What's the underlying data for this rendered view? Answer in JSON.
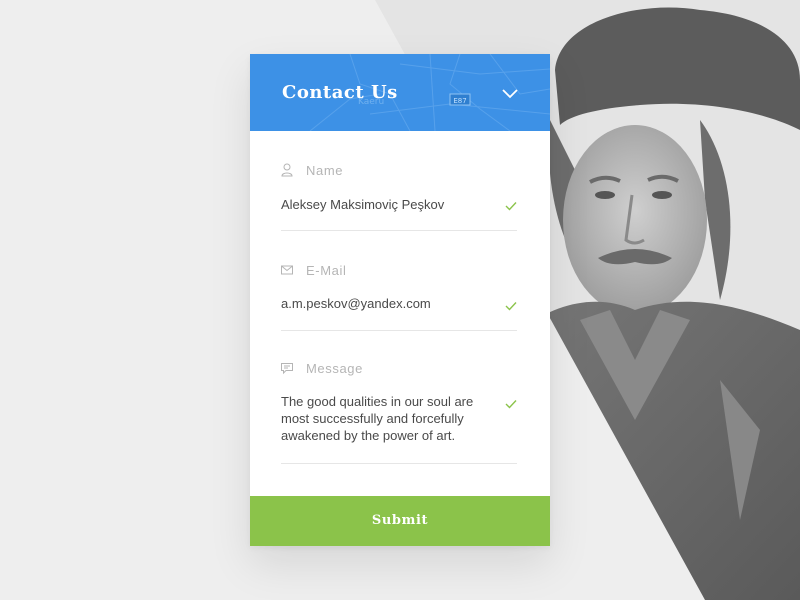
{
  "header": {
    "title": "Contact Us",
    "toggle_icon": "chevron-down-icon",
    "map_text": "Kaeru",
    "map_badge": "E87"
  },
  "form": {
    "fields": [
      {
        "icon": "person-icon",
        "label": "Name",
        "value": "Aleksey Maksimoviç Peşkov",
        "status_icon": "check-icon"
      },
      {
        "icon": "mail-icon",
        "label": "E-Mail",
        "value": "a.m.peskov@yandex.com",
        "status_icon": "check-icon"
      },
      {
        "icon": "message-icon",
        "label": "Message",
        "value": "The good qualities in our soul are most successfully and forcefully awakened by the power of art.",
        "status_icon": "check-icon"
      }
    ],
    "submit_label": "Submit"
  },
  "colors": {
    "header_blue": "#3d91e6",
    "submit_green": "#8bc34a",
    "check_green": "#8bc34a",
    "label_grey": "#b5b5b5",
    "value_text": "#4a4a4a",
    "page_background": "#eeeeee"
  }
}
